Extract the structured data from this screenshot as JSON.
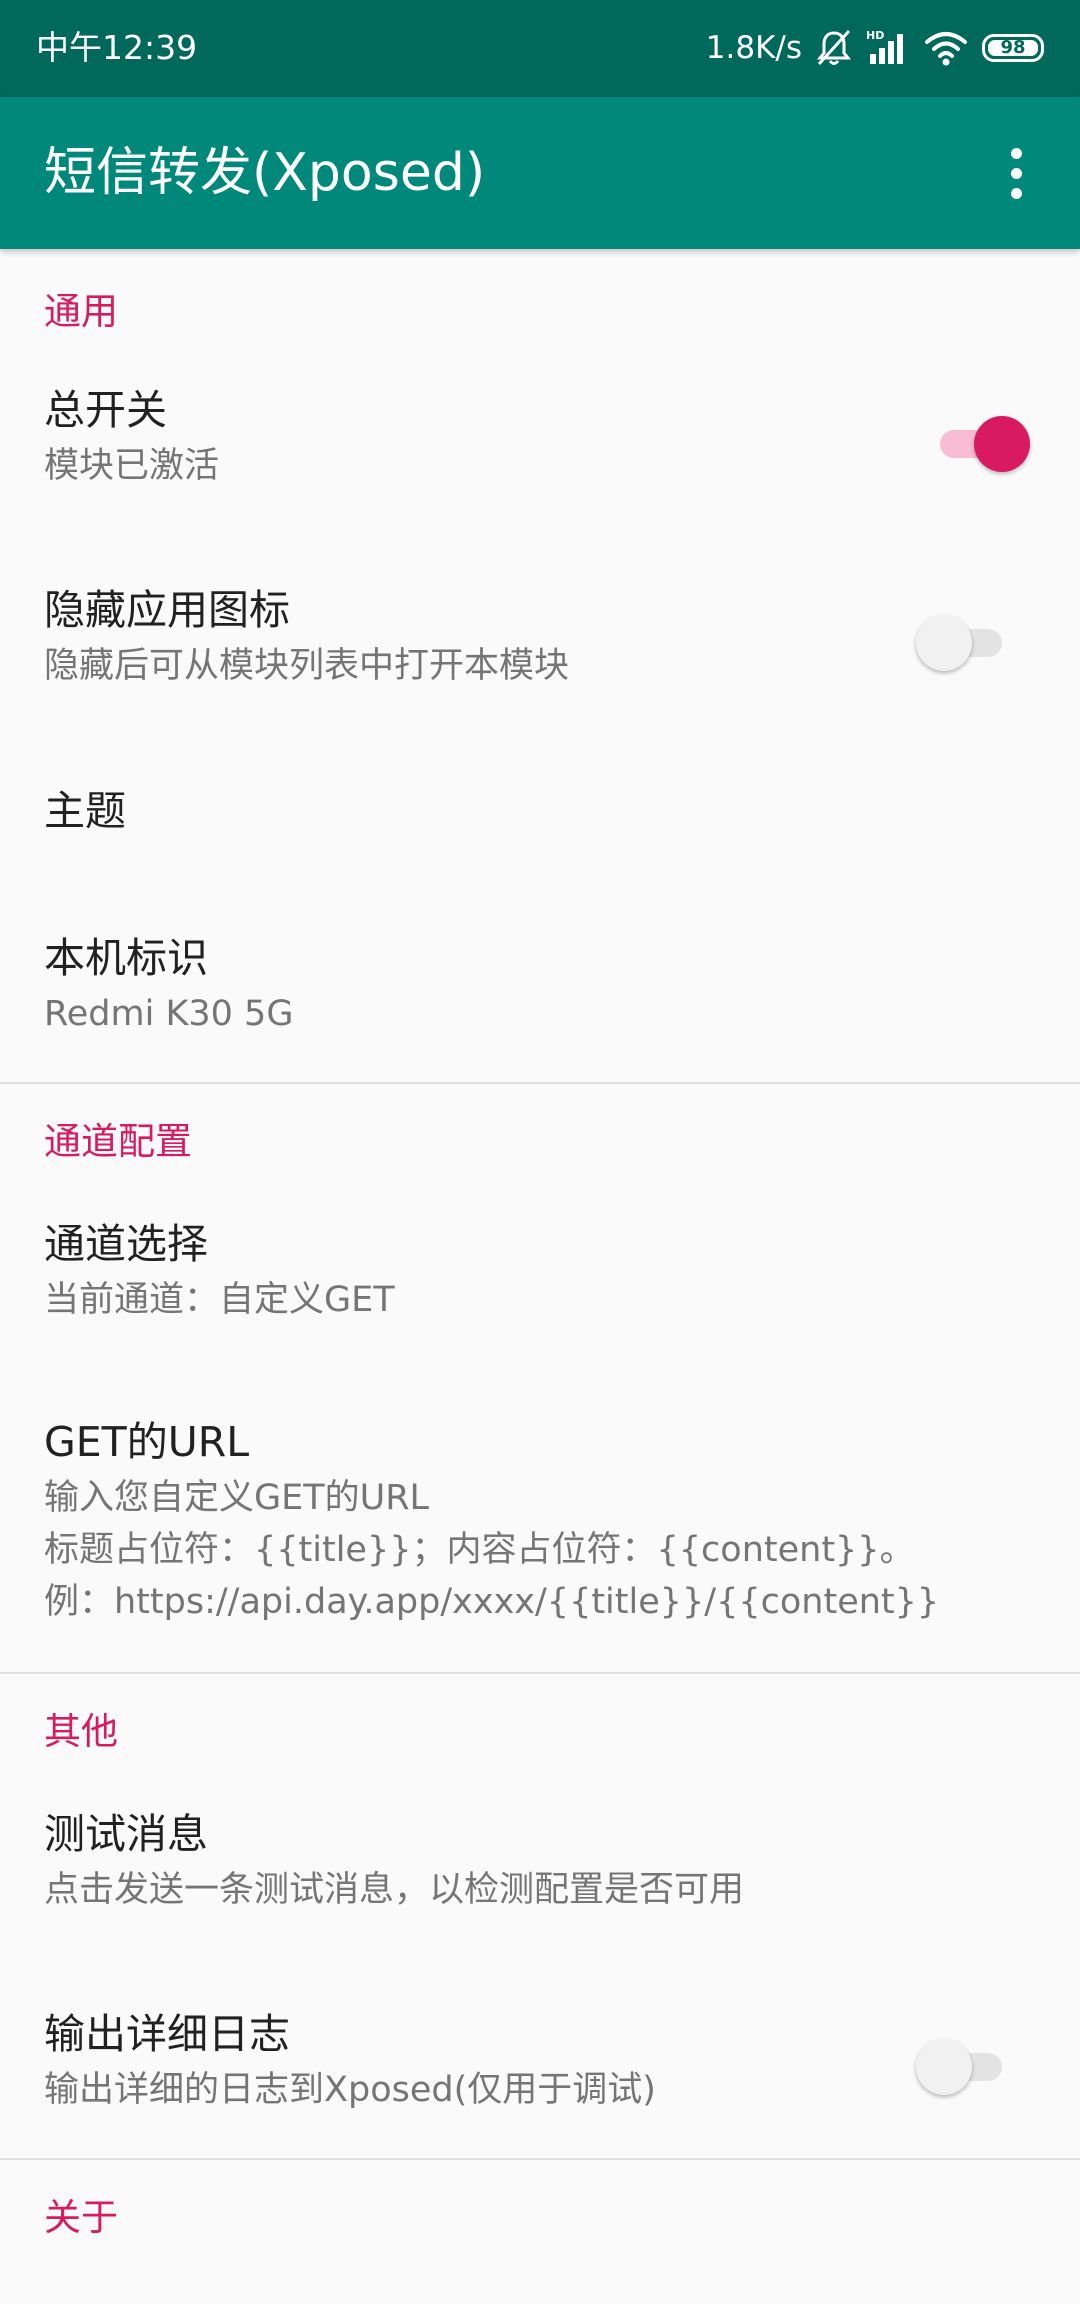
{
  "status_bar": {
    "time": "中午12:39",
    "network_speed": "1.8K/s",
    "icons": [
      "mute-icon",
      "hd-signal-icon",
      "wifi-icon",
      "battery-icon"
    ],
    "signal_label": "HD",
    "battery": "98"
  },
  "app_bar": {
    "title": "短信转发(Xposed)",
    "menu_icon": "more-vert-icon",
    "background": "#00897b",
    "status_background": "#00695c"
  },
  "colors": {
    "accent": "#d81b60",
    "title_text": "#212121",
    "summary_text": "#757575"
  },
  "sections": {
    "general": {
      "header": "通用",
      "master_switch": {
        "title": "总开关",
        "summary": "模块已激活",
        "checked": true
      },
      "hide_icon": {
        "title": "隐藏应用图标",
        "summary": "隐藏后可从模块列表中打开本模块",
        "checked": false
      },
      "theme": {
        "title": "主题"
      },
      "device_id": {
        "title": "本机标识",
        "summary": "Redmi K30 5G"
      }
    },
    "channel": {
      "header": "通道配置",
      "channel_select": {
        "title": "通道选择",
        "summary": "当前通道：自定义GET"
      },
      "get_url": {
        "title": "GET的URL",
        "summary_lines": [
          "输入您自定义GET的URL",
          "标题占位符：{{title}}；内容占位符：{{content}}。",
          "例：https://api.day.app/xxxx/{{title}}/{{content}}"
        ]
      }
    },
    "other": {
      "header": "其他",
      "test_message": {
        "title": "测试消息",
        "summary": "点击发送一条测试消息，以检测配置是否可用"
      },
      "verbose_log": {
        "title": "输出详细日志",
        "summary": "输出详细的日志到Xposed(仅用于调试)",
        "checked": false
      }
    },
    "about": {
      "header": "关于"
    }
  }
}
